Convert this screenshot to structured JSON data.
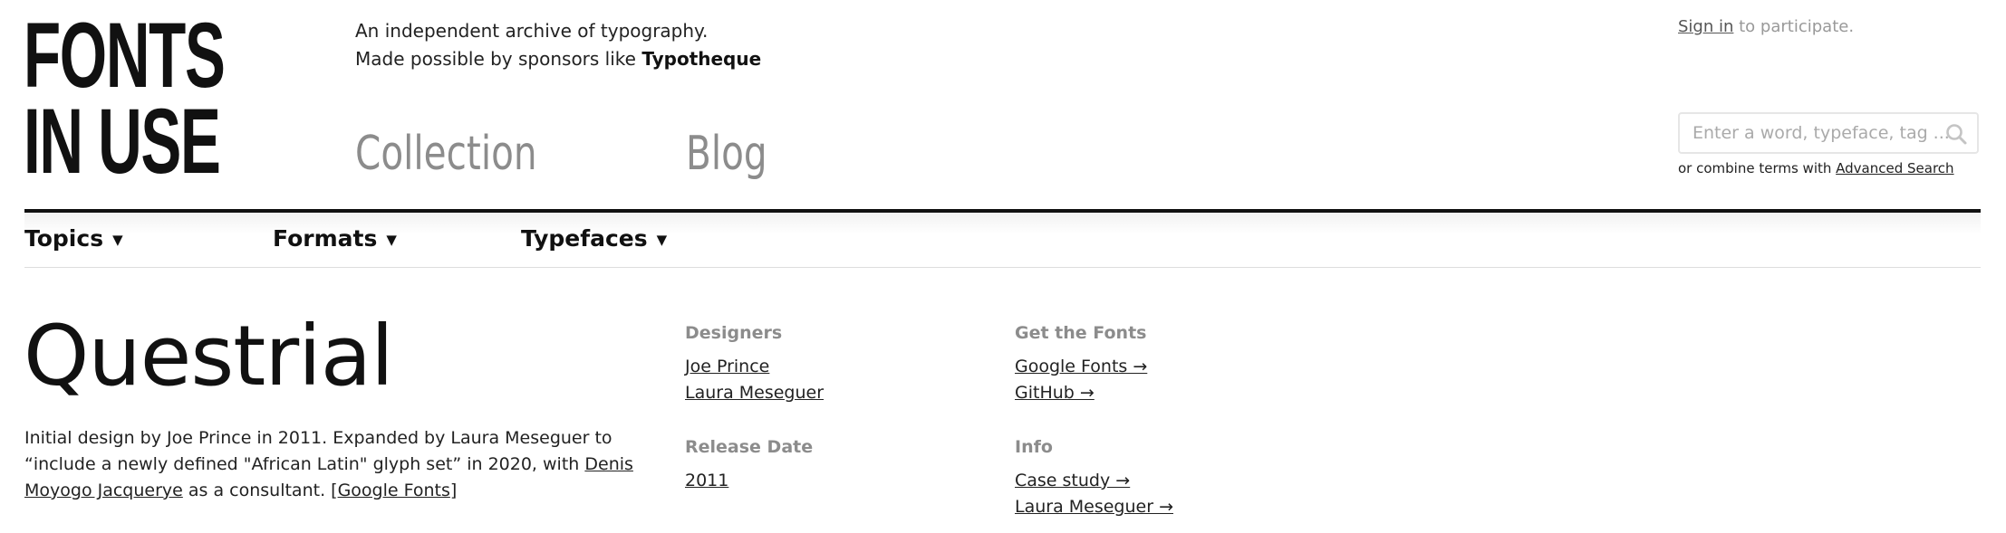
{
  "logo": {
    "line1": "FONTS",
    "line2": "IN USE"
  },
  "tagline": {
    "line1": "An independent archive of typography.",
    "line2_prefix": "Made possible by sponsors like ",
    "sponsor": "Typotheque"
  },
  "nav": {
    "collection": "Collection",
    "blog": "Blog"
  },
  "account": {
    "signin": "Sign in",
    "suffix": " to participate."
  },
  "search": {
    "placeholder": "Enter a word, typeface, tag ...",
    "value": "",
    "hint_prefix": "or combine terms with ",
    "advanced": "Advanced Search"
  },
  "subnav": [
    {
      "label": "Topics",
      "caret": "▼"
    },
    {
      "label": "Formats",
      "caret": "▼"
    },
    {
      "label": "Typefaces",
      "caret": "▼"
    }
  ],
  "typeface": {
    "name": "Questrial",
    "desc_part1": "Initial design by Joe Prince in 2011. Expanded by Laura Meseguer to “include a newly defined \"African Latin\" glyph set” in 2020, with ",
    "desc_link": "Denis Moyogo Jacquerye",
    "desc_part2": " as a consultant. [",
    "desc_source": "Google Fonts",
    "desc_end": "]"
  },
  "designers": {
    "heading": "Designers",
    "items": [
      "Joe Prince",
      "Laura Meseguer"
    ]
  },
  "release": {
    "heading": "Release Date",
    "value": "2011"
  },
  "get_fonts": {
    "heading": "Get the Fonts",
    "items": [
      "Google Fonts →",
      "GitHub →"
    ]
  },
  "info": {
    "heading": "Info",
    "items": [
      "Case study →",
      "Laura Meseguer →"
    ]
  },
  "colors": {
    "text": "#111111",
    "muted": "#8c8c8c",
    "rule": "#111111"
  }
}
